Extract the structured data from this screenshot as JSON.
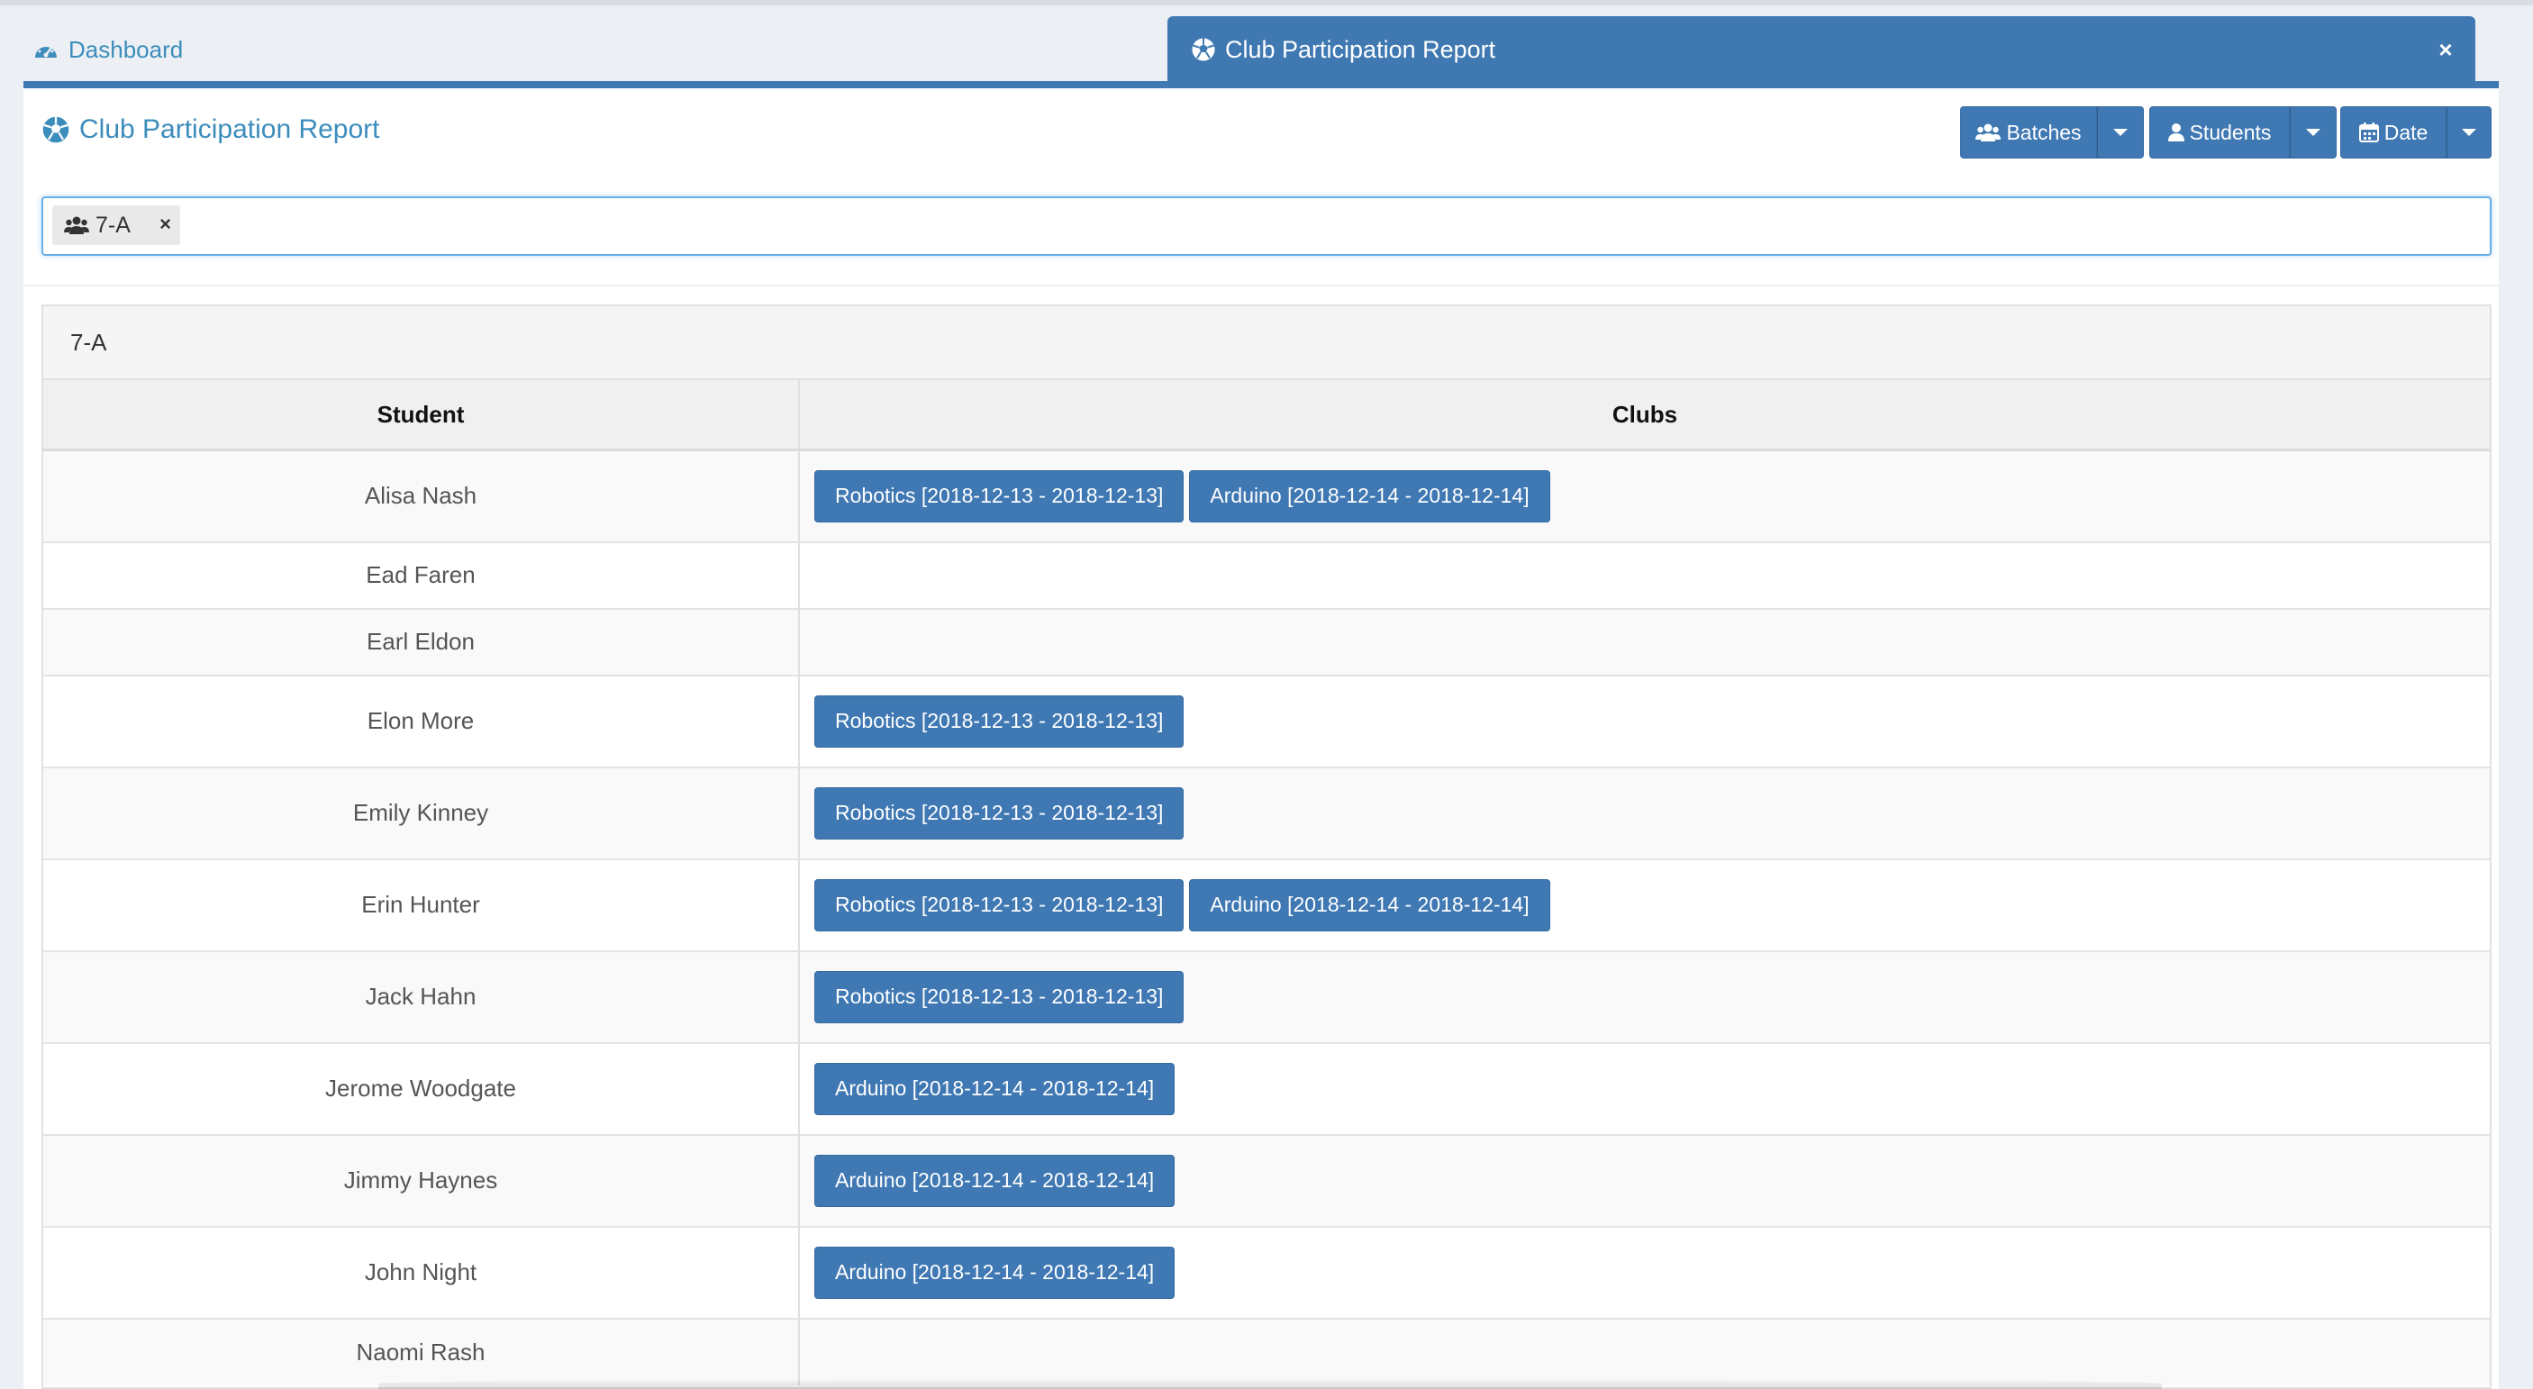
{
  "tabs": {
    "dashboard_label": "Dashboard",
    "report_label": "Club Participation Report",
    "close_label": "×"
  },
  "page": {
    "title": "Club Participation Report"
  },
  "toolbar": {
    "batches_label": "Batches",
    "students_label": "Students",
    "date_label": "Date"
  },
  "filter": {
    "chip_label": "7-A",
    "chip_remove": "×"
  },
  "batch": {
    "heading": "7-A",
    "columns": {
      "student": "Student",
      "clubs": "Clubs"
    },
    "rows": [
      {
        "student": "Alisa Nash",
        "clubs": [
          "Robotics [2018-12-13 - 2018-12-13]",
          "Arduino [2018-12-14 - 2018-12-14]"
        ]
      },
      {
        "student": "Ead Faren",
        "clubs": []
      },
      {
        "student": "Earl Eldon",
        "clubs": []
      },
      {
        "student": "Elon More",
        "clubs": [
          "Robotics [2018-12-13 - 2018-12-13]"
        ]
      },
      {
        "student": "Emily Kinney",
        "clubs": [
          "Robotics [2018-12-13 - 2018-12-13]"
        ]
      },
      {
        "student": "Erin Hunter",
        "clubs": [
          "Robotics [2018-12-13 - 2018-12-13]",
          "Arduino [2018-12-14 - 2018-12-14]"
        ]
      },
      {
        "student": "Jack Hahn",
        "clubs": [
          "Robotics [2018-12-13 - 2018-12-13]"
        ]
      },
      {
        "student": "Jerome Woodgate",
        "clubs": [
          "Arduino [2018-12-14 - 2018-12-14]"
        ]
      },
      {
        "student": "Jimmy Haynes",
        "clubs": [
          "Arduino [2018-12-14 - 2018-12-14]"
        ]
      },
      {
        "student": "John Night",
        "clubs": [
          "Arduino [2018-12-14 - 2018-12-14]"
        ]
      },
      {
        "student": "Naomi Rash",
        "clubs": []
      }
    ]
  },
  "icons": {
    "dashboard": "dashboard-gauge-icon",
    "report": "soccer-ball-icon",
    "batches": "users-group-icon",
    "students": "user-icon",
    "date": "calendar-icon"
  },
  "colors": {
    "primary": "#3f78b3",
    "link": "#3c8dbc",
    "background": "#ecf0f5"
  }
}
